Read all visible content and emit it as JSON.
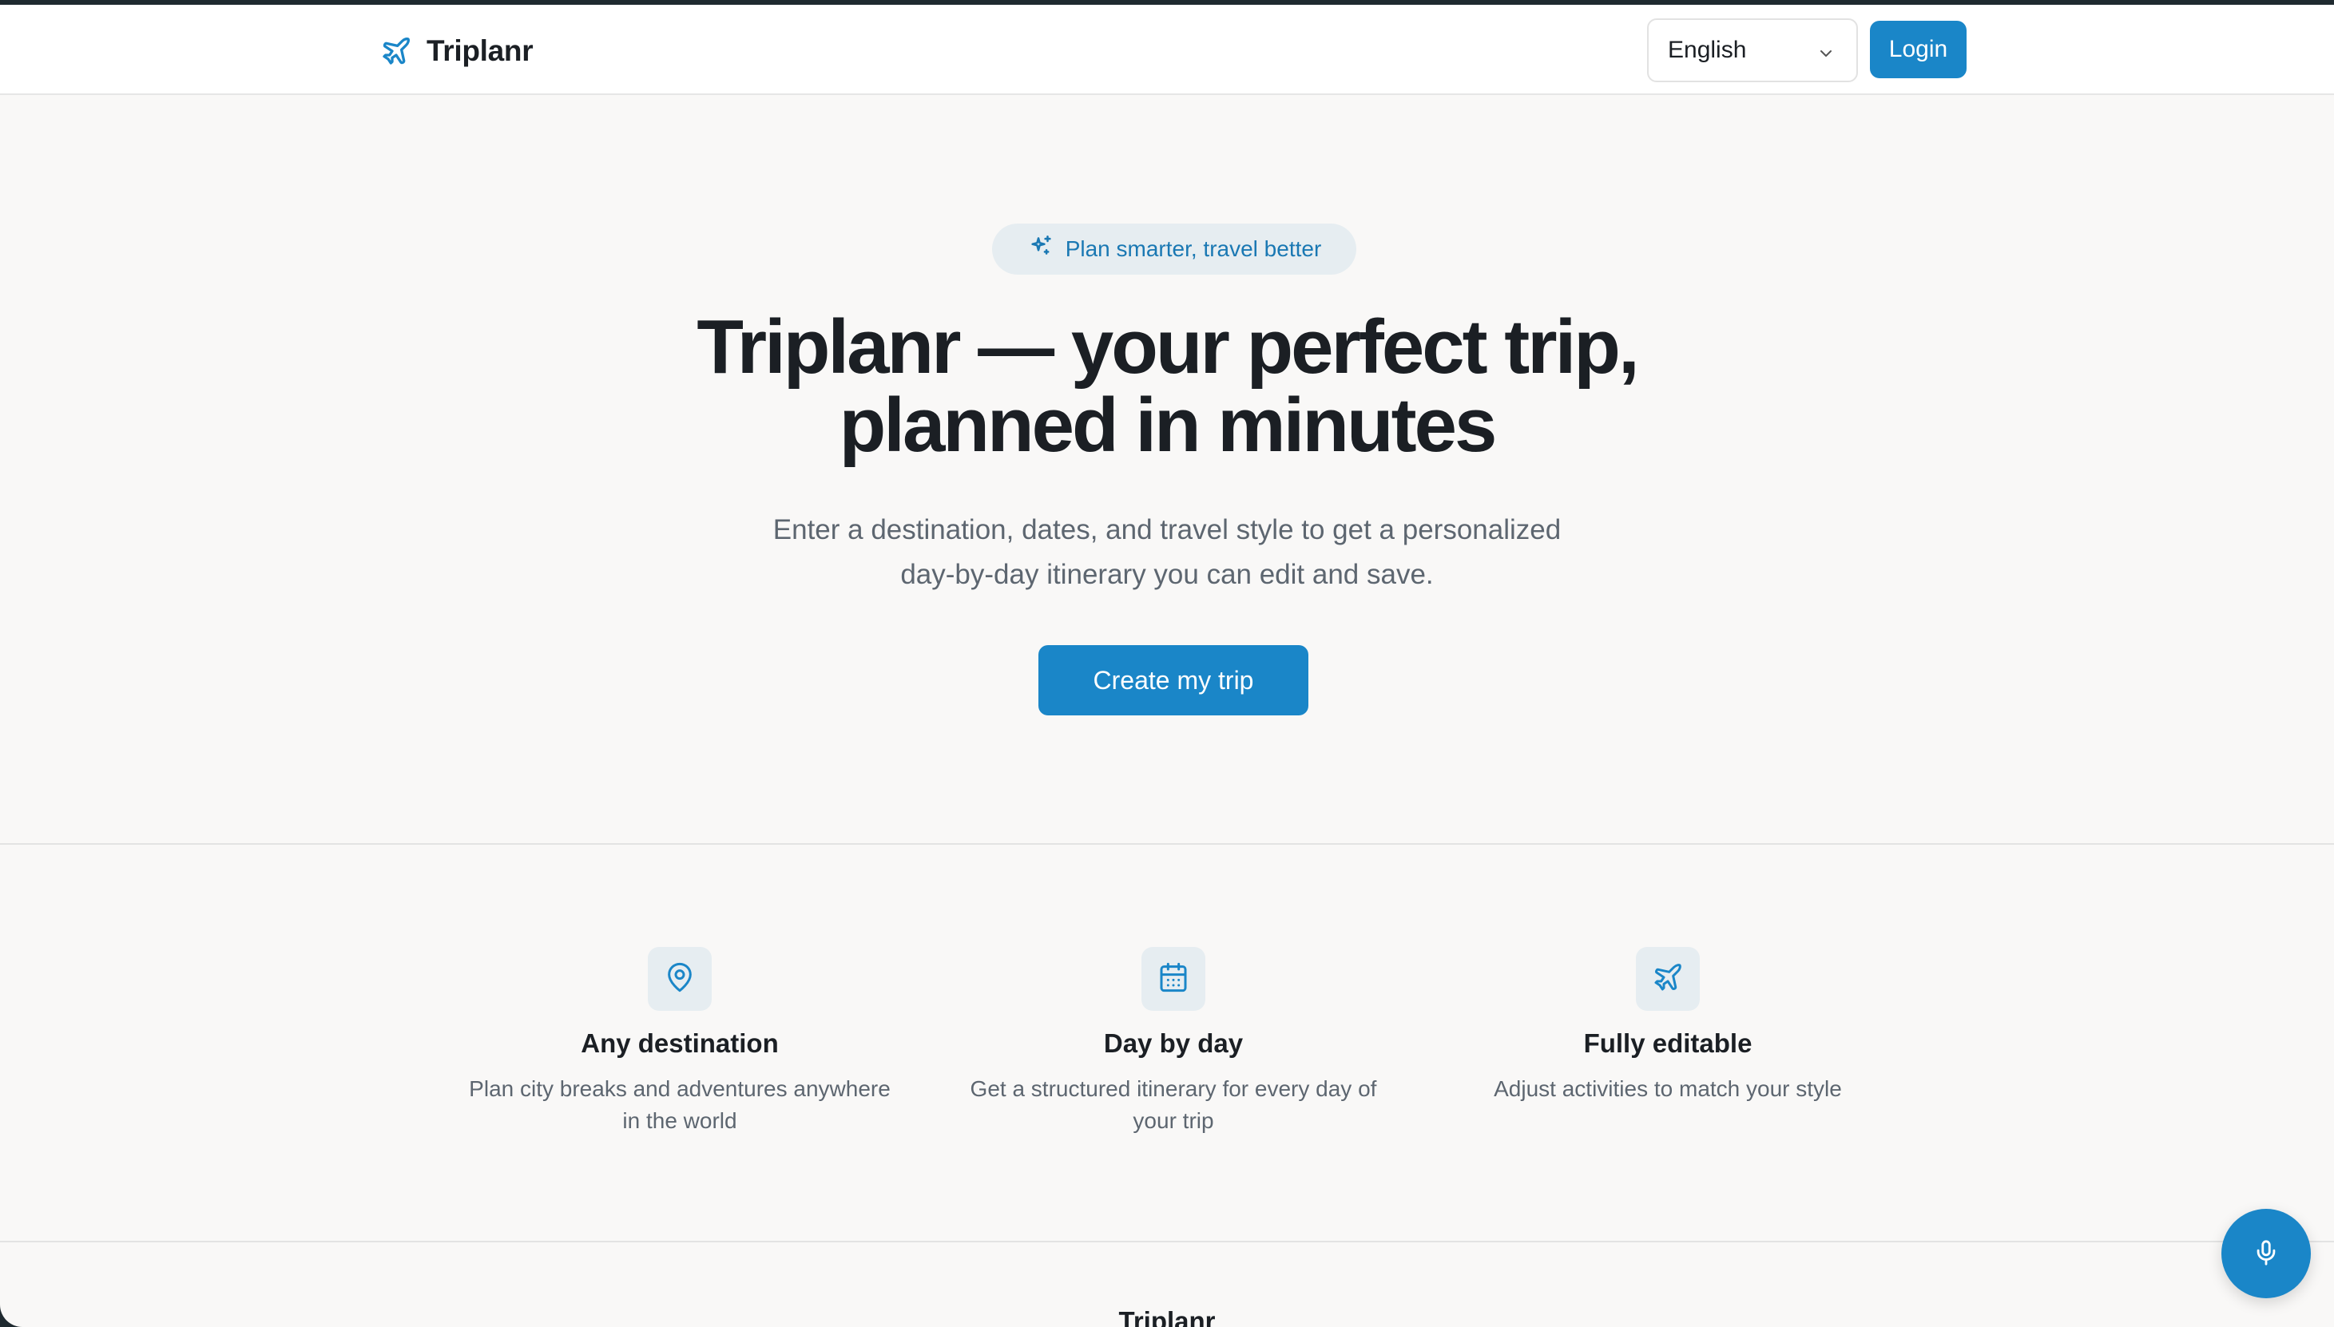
{
  "brand": {
    "name": "Triplanr",
    "icon": "plane-icon"
  },
  "header": {
    "language": "English",
    "login_label": "Login"
  },
  "hero": {
    "badge_text": "Plan smarter, travel better",
    "title_line1": "Triplanr — your perfect trip,",
    "title_line2": "planned in minutes",
    "subtitle_line1": "Enter a destination, dates, and travel style to get a personalized",
    "subtitle_line2": "day-by-day itinerary you can edit and save.",
    "cta_label": "Create my trip"
  },
  "features": [
    {
      "icon": "map-pin-icon",
      "title": "Any destination",
      "line1": "Plan city breaks and adventures anywhere",
      "line2": "in the world"
    },
    {
      "icon": "calendar-icon",
      "title": "Day by day",
      "line1": "Get a structured itinerary for every day of",
      "line2": "your trip"
    },
    {
      "icon": "plane-icon",
      "title": "Fully editable",
      "line1": "Adjust activities to match your style",
      "line2": ""
    }
  ],
  "footer": {
    "title": "Triplanr"
  },
  "colors": {
    "accent": "#1a86c8",
    "text": "#1b1f24",
    "muted": "#5d6670",
    "background": "#f9f8f7"
  }
}
